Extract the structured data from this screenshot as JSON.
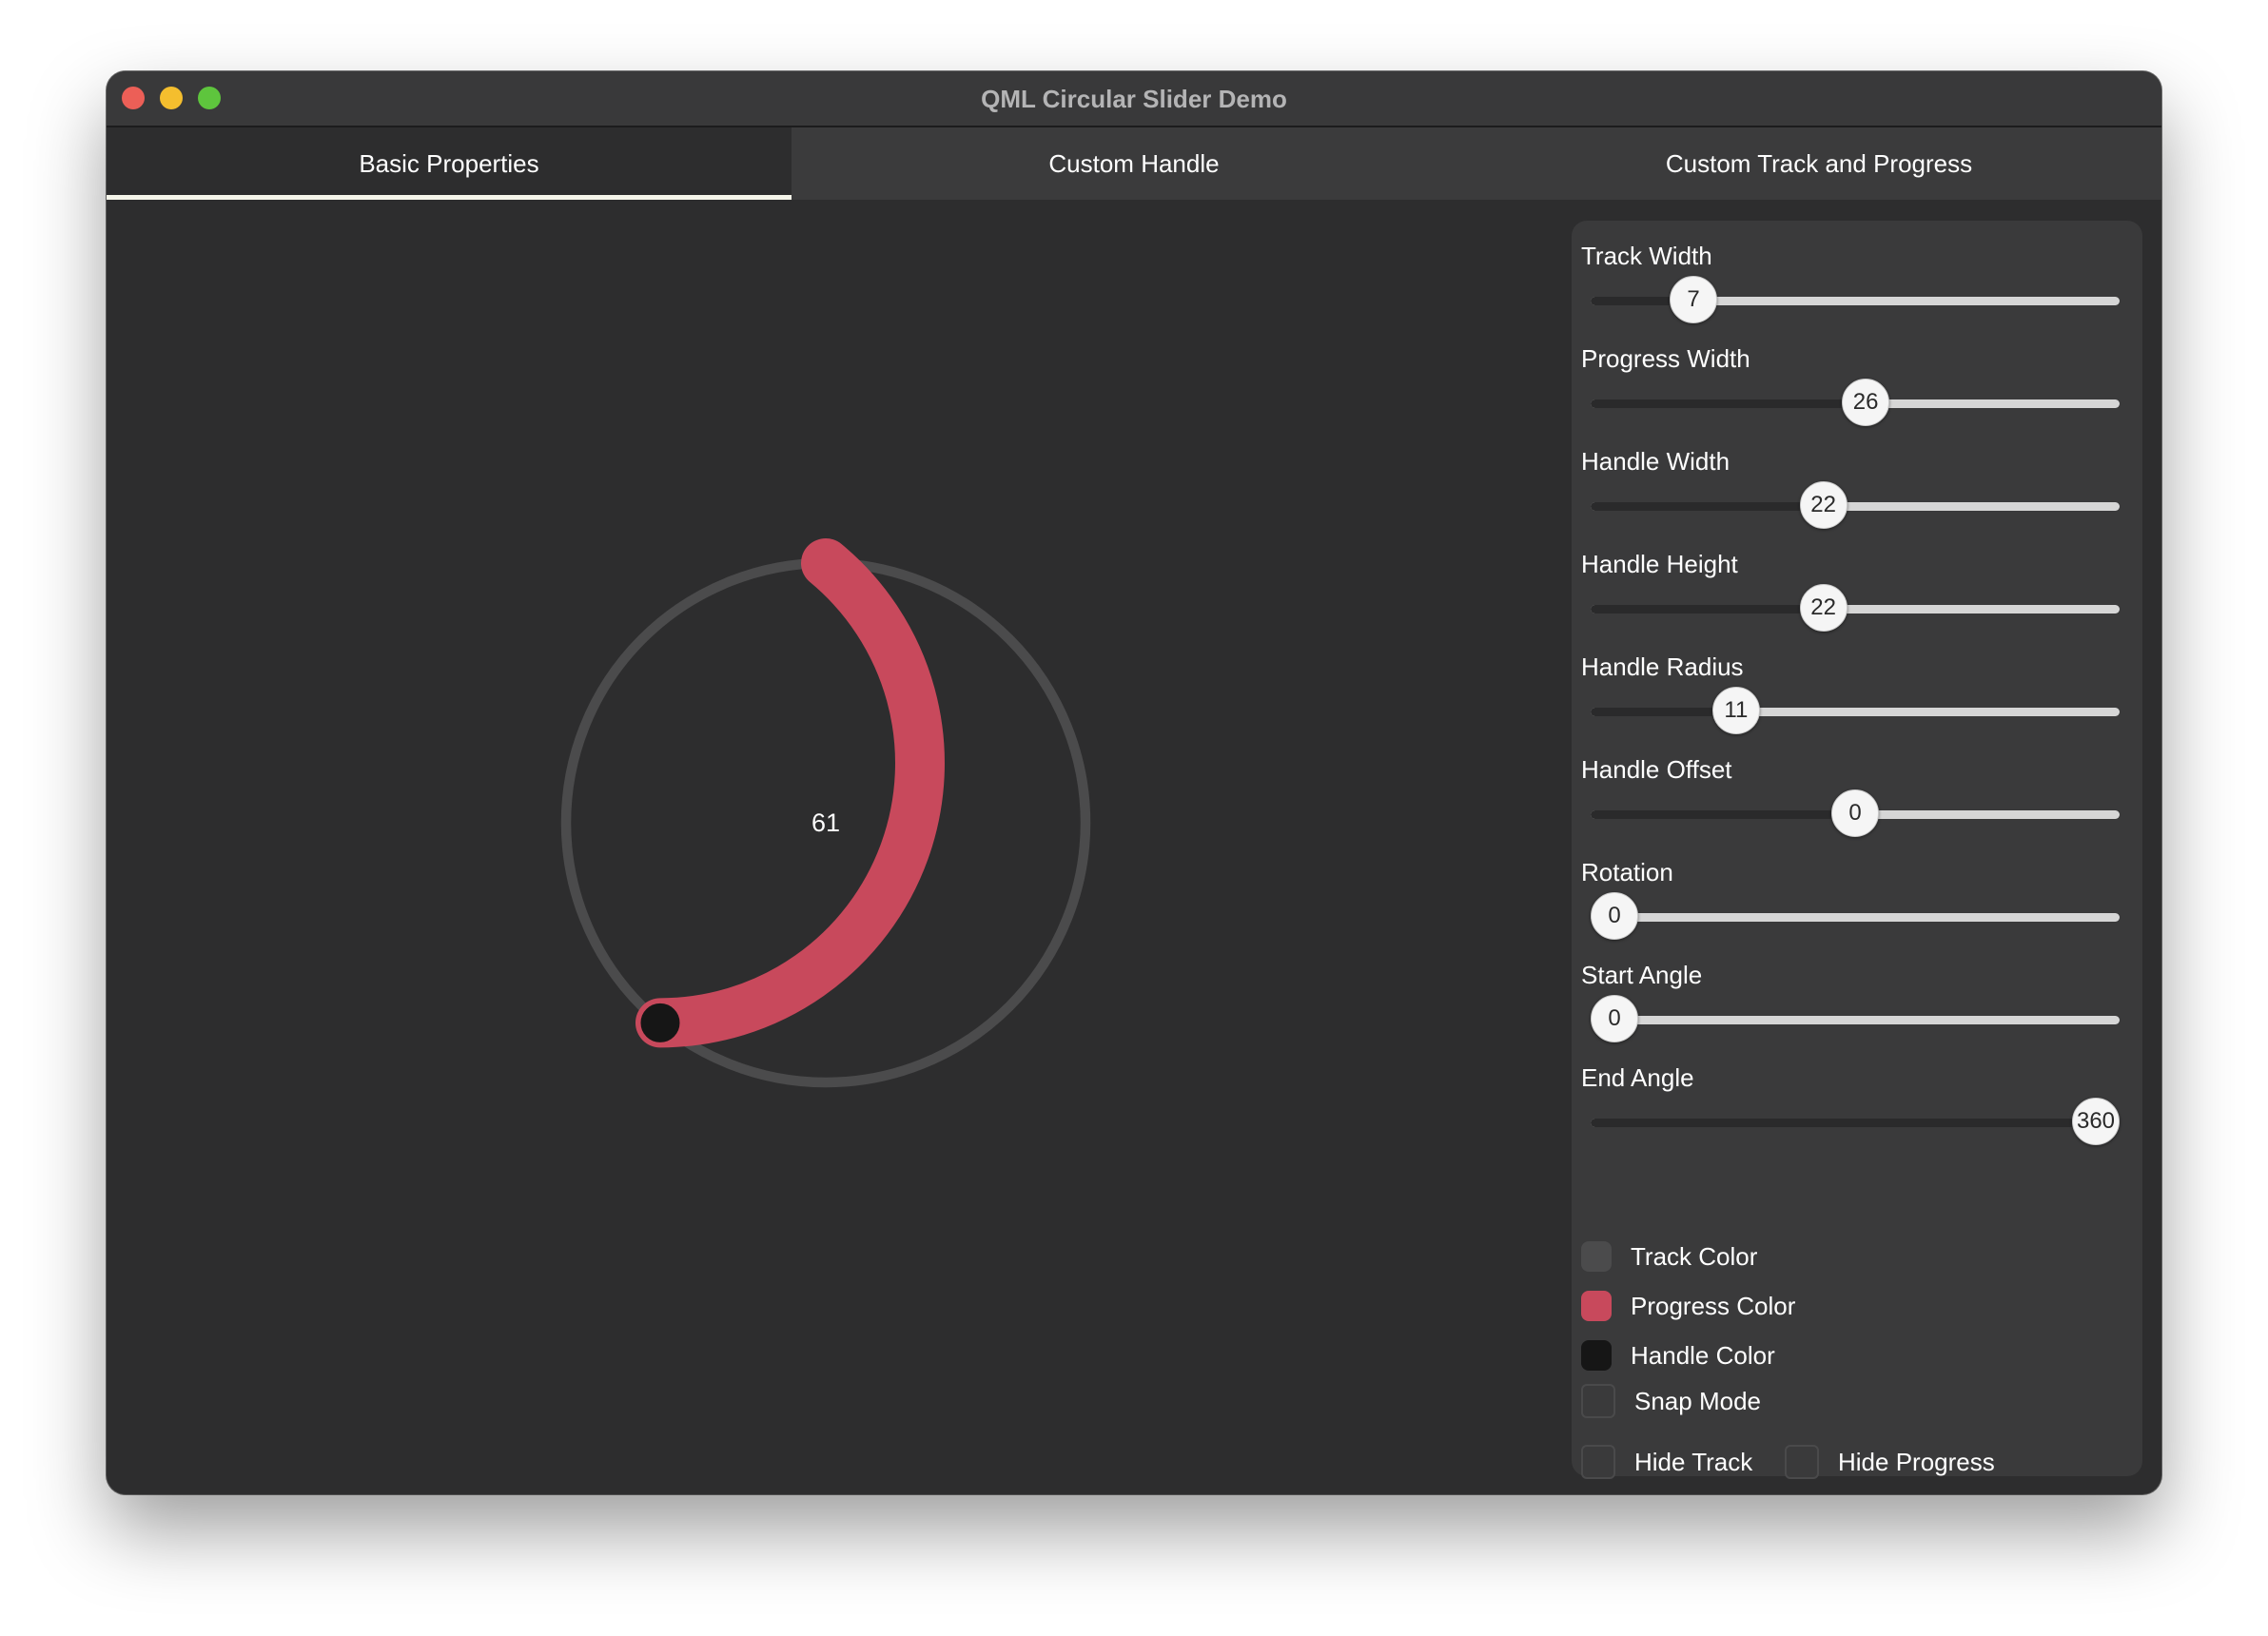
{
  "window": {
    "title": "QML Circular Slider Demo"
  },
  "tabs": [
    {
      "label": "Basic Properties",
      "active": true
    },
    {
      "label": "Custom Handle",
      "active": false
    },
    {
      "label": "Custom Track and Progress",
      "active": false
    }
  ],
  "dial": {
    "value": 61,
    "display": "61",
    "min": 0,
    "max": 100,
    "track_color": "#4b4b4c",
    "progress_color": "#c8495c",
    "handle_color": "#161616"
  },
  "sliders": [
    {
      "label": "Track Width",
      "value": 7,
      "min": 0,
      "max": 36,
      "display": "7"
    },
    {
      "label": "Progress Width",
      "value": 26,
      "min": 0,
      "max": 50,
      "display": "26"
    },
    {
      "label": "Handle Width",
      "value": 22,
      "min": 0,
      "max": 50,
      "display": "22"
    },
    {
      "label": "Handle Height",
      "value": 22,
      "min": 0,
      "max": 50,
      "display": "22"
    },
    {
      "label": "Handle Radius",
      "value": 11,
      "min": 0,
      "max": 40,
      "display": "11"
    },
    {
      "label": "Handle Offset",
      "value": 0,
      "min": -50,
      "max": 50,
      "display": "0"
    },
    {
      "label": "Rotation",
      "value": 0,
      "min": 0,
      "max": 360,
      "display": "0"
    },
    {
      "label": "Start Angle",
      "value": 0,
      "min": 0,
      "max": 360,
      "display": "0"
    },
    {
      "label": "End Angle",
      "value": 360,
      "min": 0,
      "max": 360,
      "display": "360"
    }
  ],
  "color_options": [
    {
      "label": "Track Color",
      "color": "#4b4b4c"
    },
    {
      "label": "Progress Color",
      "color": "#c8495c"
    },
    {
      "label": "Handle Color",
      "color": "#161616"
    }
  ],
  "checkboxes": {
    "snap_mode": {
      "label": "Snap Mode",
      "checked": false
    },
    "hide_track": {
      "label": "Hide Track",
      "checked": false
    },
    "hide_progress": {
      "label": "Hide Progress",
      "checked": false
    }
  }
}
